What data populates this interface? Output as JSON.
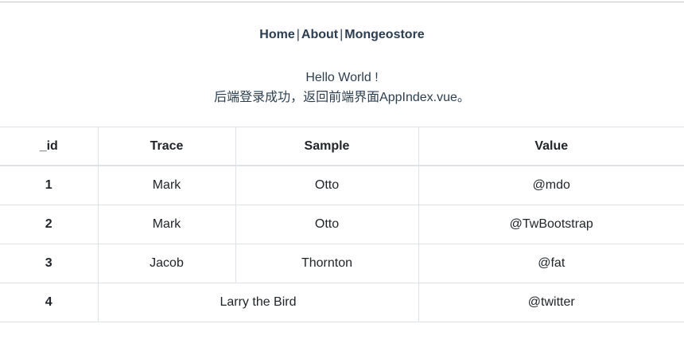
{
  "nav": {
    "links": [
      "Home",
      "About",
      "Mongeostore"
    ],
    "separator": "|"
  },
  "messages": {
    "greeting": "Hello World !",
    "status": "后端登录成功，返回前端界面AppIndex.vue。"
  },
  "table": {
    "headers": [
      "_id",
      "Trace",
      "Sample",
      "Value"
    ],
    "rows": [
      {
        "id": "1",
        "trace": "Mark",
        "sample": "Otto",
        "value": "@mdo"
      },
      {
        "id": "2",
        "trace": "Mark",
        "sample": "Otto",
        "value": "@TwBootstrap"
      },
      {
        "id": "3",
        "trace": "Jacob",
        "sample": "Thornton",
        "value": "@fat"
      },
      {
        "id": "4",
        "merged": "Larry the Bird",
        "value": "@twitter"
      }
    ]
  }
}
